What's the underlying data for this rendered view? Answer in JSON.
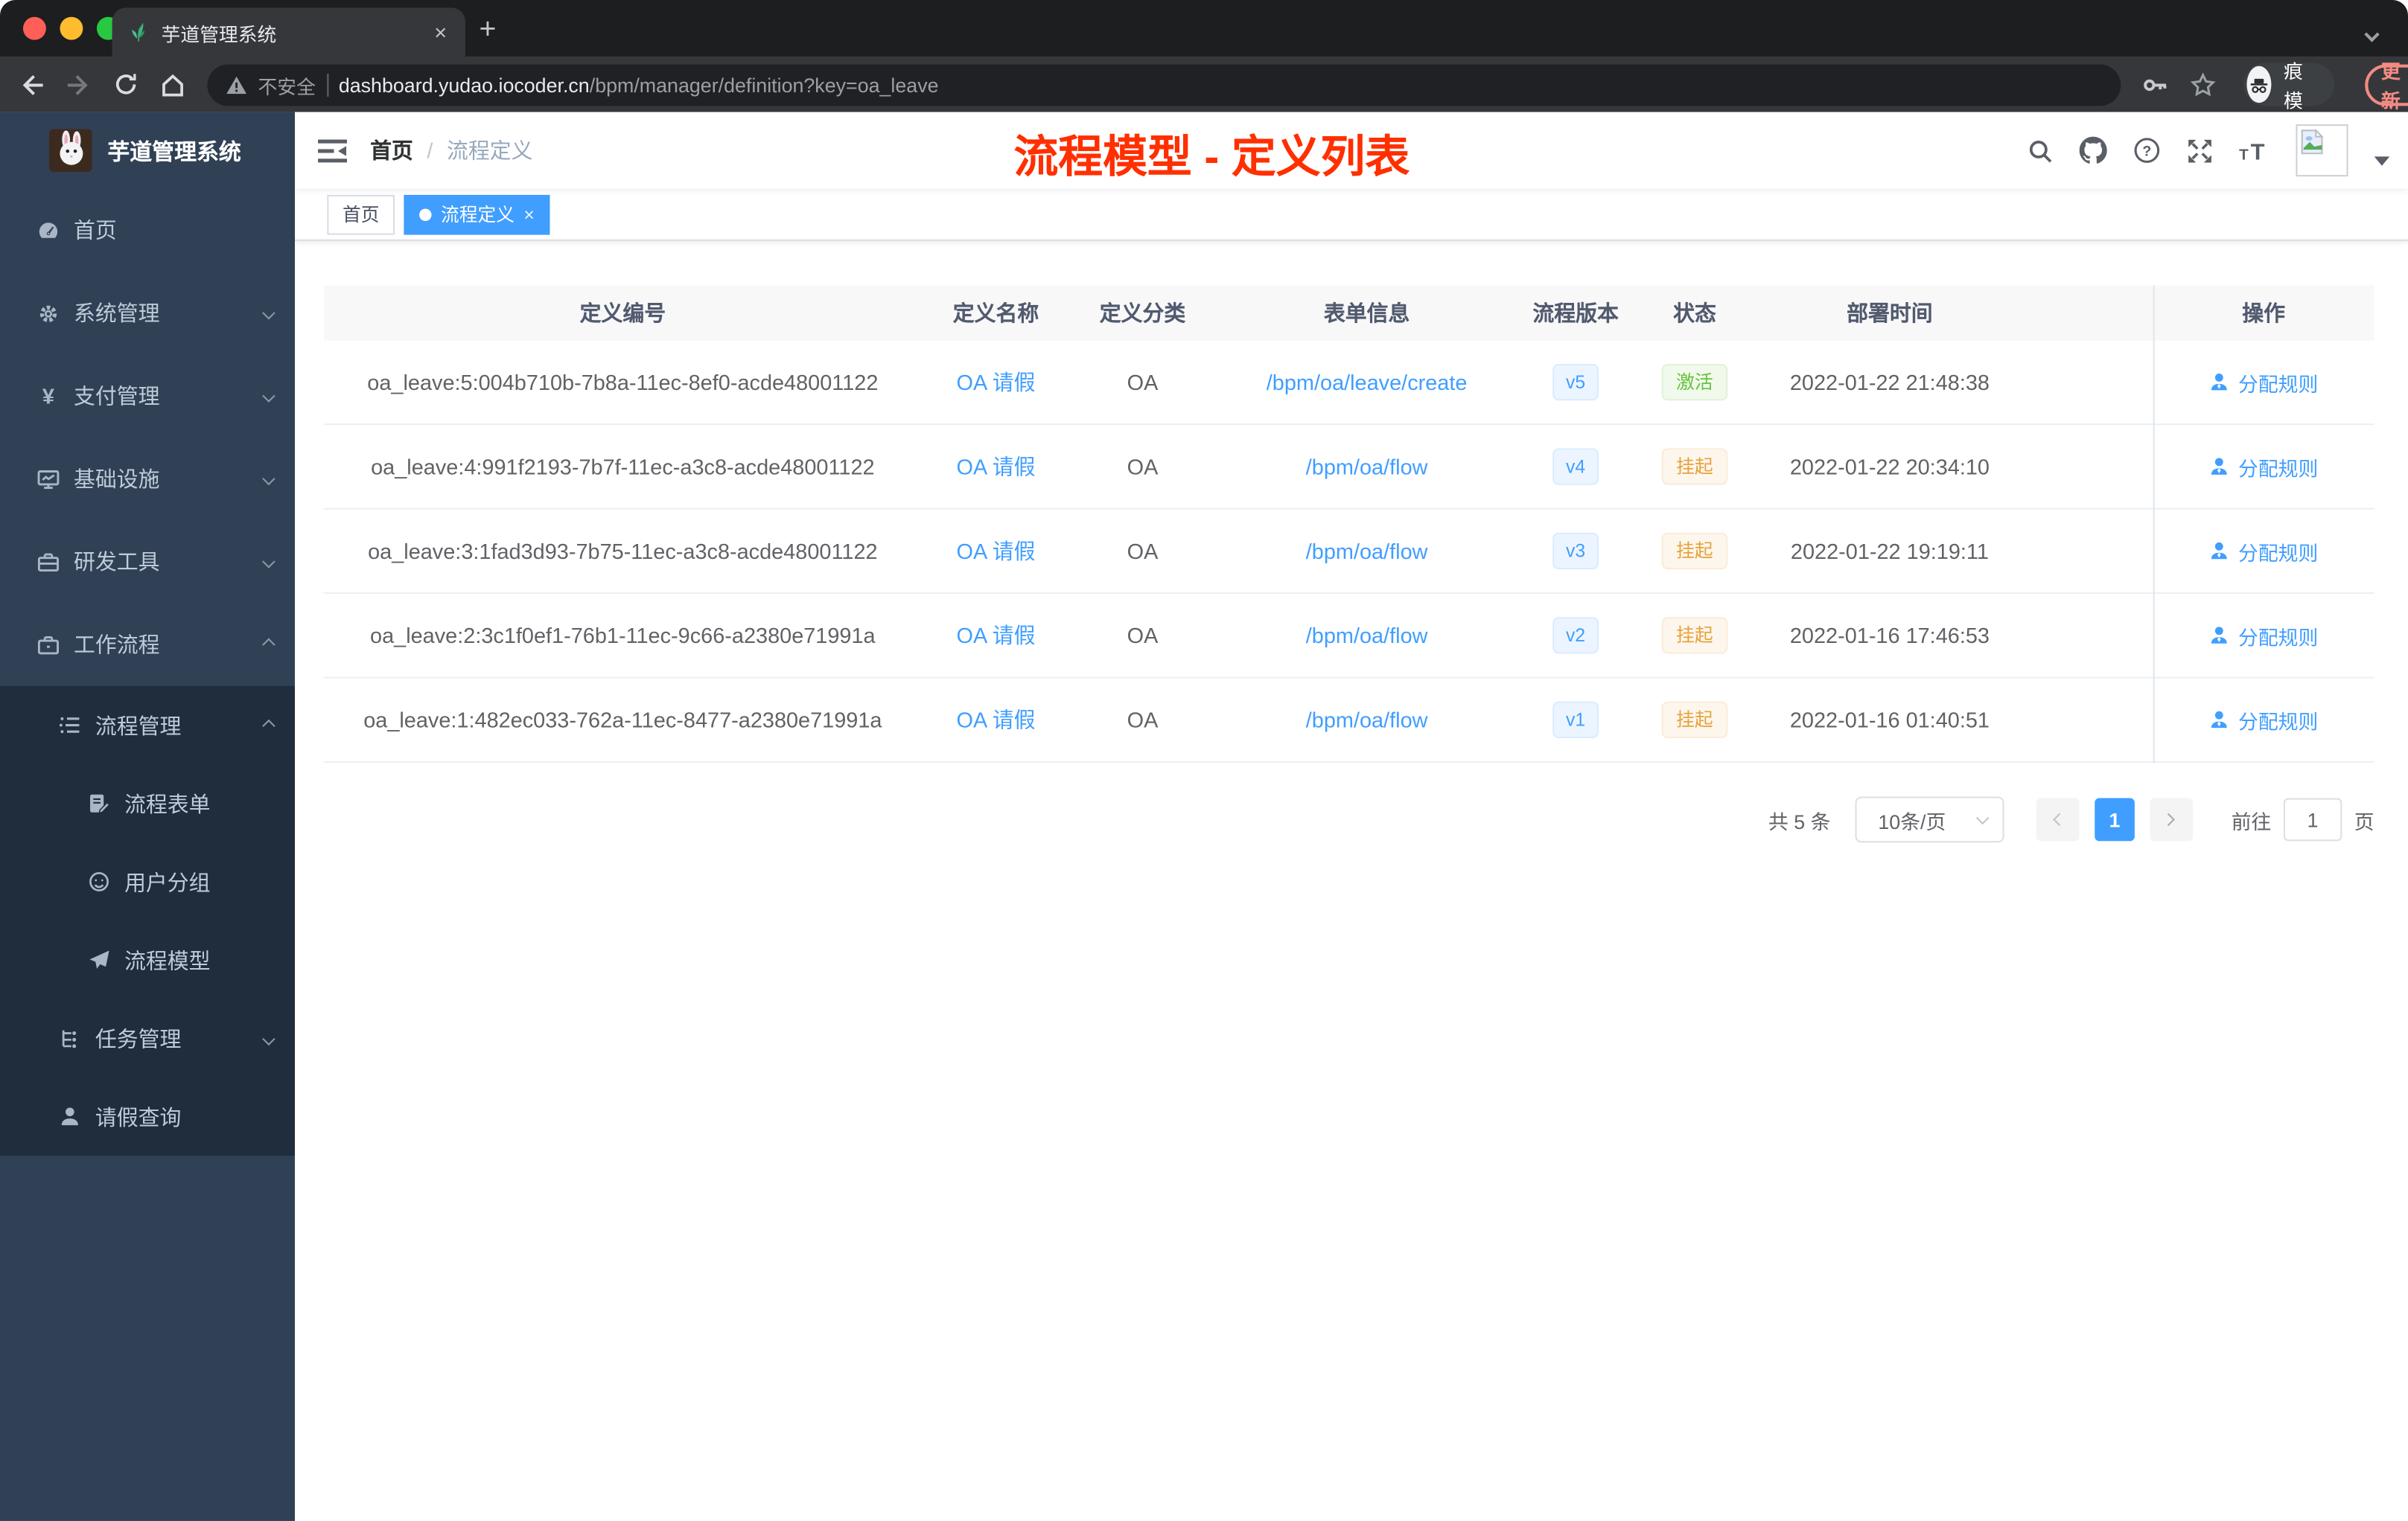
{
  "browser": {
    "tab_title": "芋道管理系统",
    "not_secure_label": "不安全",
    "url_domain": "dashboard.yudao.iocoder.cn",
    "url_path": "/bpm/manager/definition?key=oa_leave",
    "incognito_label": "无痕模式",
    "update_label": "更新",
    "new_tab_label": "+",
    "tab_close_label": "×"
  },
  "sidebar": {
    "logo_title": "芋道管理系统",
    "items": [
      {
        "label": "首页",
        "icon": "dashboard-icon",
        "level": 1,
        "chevron": null
      },
      {
        "label": "系统管理",
        "icon": "gear-icon",
        "level": 1,
        "chevron": "down"
      },
      {
        "label": "支付管理",
        "icon": "yen-icon",
        "level": 1,
        "chevron": "down"
      },
      {
        "label": "基础设施",
        "icon": "monitor-icon",
        "level": 1,
        "chevron": "down"
      },
      {
        "label": "研发工具",
        "icon": "toolbox-icon",
        "level": 1,
        "chevron": "down"
      },
      {
        "label": "工作流程",
        "icon": "briefcase-icon",
        "level": 1,
        "chevron": "up"
      },
      {
        "label": "流程管理",
        "icon": "list-icon",
        "level": 2,
        "chevron": "up"
      },
      {
        "label": "流程表单",
        "icon": "form-edit-icon",
        "level": 3,
        "chevron": null
      },
      {
        "label": "用户分组",
        "icon": "face-icon",
        "level": 3,
        "chevron": null
      },
      {
        "label": "流程模型",
        "icon": "send-icon",
        "level": 3,
        "chevron": null
      },
      {
        "label": "任务管理",
        "icon": "tree-icon",
        "level": 2,
        "chevron": "down"
      },
      {
        "label": "请假查询",
        "icon": "user-icon",
        "level": 2,
        "chevron": null
      }
    ]
  },
  "navbar": {
    "breadcrumb_home": "首页",
    "breadcrumb_separator": "/",
    "breadcrumb_current": "流程定义",
    "annotation_title": "流程模型 - 定义列表",
    "icons": [
      "search-icon",
      "github-icon",
      "help-icon",
      "fullscreen-icon",
      "font-size-icon",
      "avatar",
      "caret-down-icon"
    ]
  },
  "tags": {
    "home_label": "首页",
    "active_label": "流程定义",
    "active_close": "×"
  },
  "table": {
    "columns": [
      "定义编号",
      "定义名称",
      "定义分类",
      "表单信息",
      "流程版本",
      "状态",
      "部署时间",
      "操作"
    ],
    "rows": [
      {
        "id": "oa_leave:5:004b710b-7b8a-11ec-8ef0-acde48001122",
        "name": "OA 请假",
        "category": "OA",
        "form": "/bpm/oa/leave/create",
        "version": "v5",
        "status": "激活",
        "status_type": "success",
        "time": "2022-01-22 21:48:38",
        "action": "分配规则"
      },
      {
        "id": "oa_leave:4:991f2193-7b7f-11ec-a3c8-acde48001122",
        "name": "OA 请假",
        "category": "OA",
        "form": "/bpm/oa/flow",
        "version": "v4",
        "status": "挂起",
        "status_type": "warning",
        "time": "2022-01-22 20:34:10",
        "action": "分配规则"
      },
      {
        "id": "oa_leave:3:1fad3d93-7b75-11ec-a3c8-acde48001122",
        "name": "OA 请假",
        "category": "OA",
        "form": "/bpm/oa/flow",
        "version": "v3",
        "status": "挂起",
        "status_type": "warning",
        "time": "2022-01-22 19:19:11",
        "action": "分配规则"
      },
      {
        "id": "oa_leave:2:3c1f0ef1-76b1-11ec-9c66-a2380e71991a",
        "name": "OA 请假",
        "category": "OA",
        "form": "/bpm/oa/flow",
        "version": "v2",
        "status": "挂起",
        "status_type": "warning",
        "time": "2022-01-16 17:46:53",
        "action": "分配规则"
      },
      {
        "id": "oa_leave:1:482ec033-762a-11ec-8477-a2380e71991a",
        "name": "OA 请假",
        "category": "OA",
        "form": "/bpm/oa/flow",
        "version": "v1",
        "status": "挂起",
        "status_type": "warning",
        "time": "2022-01-16 01:40:51",
        "action": "分配规则"
      }
    ]
  },
  "pagination": {
    "total_label": "共 5 条",
    "page_size_label": "10条/页",
    "current_page": "1",
    "goto_label": "前往",
    "goto_value": "1",
    "page_unit_label": "页"
  },
  "colors": {
    "accent_blue": "#409eff",
    "sidebar_bg": "#304156",
    "submenu_bg": "#1f2d3d",
    "annotation_red": "#ff2f00",
    "success_green": "#67c23a",
    "warning_orange": "#e6a23c"
  }
}
